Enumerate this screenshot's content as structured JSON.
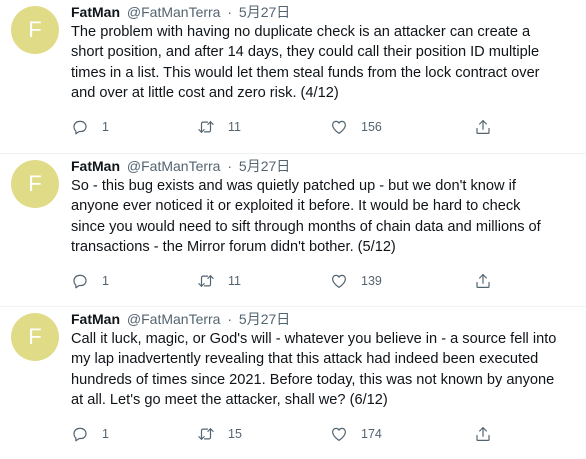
{
  "tweets": [
    {
      "avatar_letter": "F",
      "name": "FatMan",
      "handle": "@FatManTerra",
      "separator": "·",
      "date": "5月27日",
      "lines": [
        "The problem with having no duplicate check is an attacker can create a",
        "short position, and after 14 days, they could call their position ID multiple",
        "times in a list. This would let them steal funds from the lock contract over",
        "and over at little cost and zero risk. (4/12)"
      ],
      "replies": "1",
      "retweets": "11",
      "likes": "156"
    },
    {
      "avatar_letter": "F",
      "name": "FatMan",
      "handle": "@FatManTerra",
      "separator": "·",
      "date": "5月27日",
      "lines": [
        "So - this bug exists and was quietly patched up - but we don't know if",
        "anyone ever noticed it or exploited it before. It would be hard to check",
        "since you would need to sift through months of chain data and millions of",
        "transactions - the Mirror forum didn't bother. (5/12)"
      ],
      "replies": "1",
      "retweets": "11",
      "likes": "139"
    },
    {
      "avatar_letter": "F",
      "name": "FatMan",
      "handle": "@FatManTerra",
      "separator": "·",
      "date": "5月27日",
      "lines": [
        "Call it luck, magic, or God's will - whatever you believe in - a source fell into",
        "my lap inadvertently revealing that this attack had indeed been executed",
        "hundreds of times since 2021. Before today, this was not known by anyone",
        "at all. Let's go meet the attacker, shall we? (6/12)"
      ],
      "replies": "1",
      "retweets": "15",
      "likes": "174"
    }
  ],
  "icons": {
    "reply": "reply-icon",
    "retweet": "retweet-icon",
    "like": "heart-icon",
    "share": "share-icon"
  },
  "colors": {
    "avatar_bg": "#e0db86",
    "text": "#0f1419",
    "muted": "#536471",
    "divider": "#eff3f4"
  }
}
